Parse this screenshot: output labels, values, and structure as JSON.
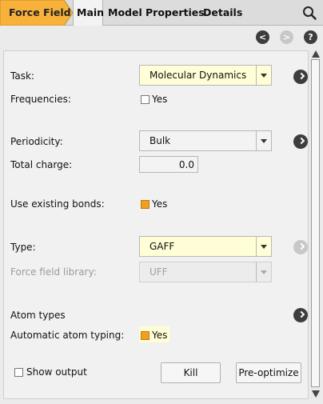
{
  "tabs": {
    "force_field": "Force Field",
    "main": "Main",
    "model": "Model",
    "properties": "Properties",
    "details": "Details"
  },
  "nav": {
    "back": "<",
    "forward": ">",
    "help": "?"
  },
  "fields": {
    "task": {
      "label": "Task:",
      "value": "Molecular Dynamics"
    },
    "frequencies": {
      "label": "Frequencies:",
      "checked": false,
      "option": "Yes"
    },
    "periodicity": {
      "label": "Periodicity:",
      "value": "Bulk"
    },
    "total_charge": {
      "label": "Total charge:",
      "value": "0.0"
    },
    "use_existing_bonds": {
      "label": "Use existing bonds:",
      "checked": true,
      "option": "Yes"
    },
    "type": {
      "label": "Type:",
      "value": "GAFF"
    },
    "force_field_library": {
      "label": "Force field library:",
      "value": "UFF",
      "disabled": true
    },
    "atom_types": {
      "label": "Atom types"
    },
    "automatic_atom_typing": {
      "label": "Automatic atom typing:",
      "checked": true,
      "option": "Yes"
    }
  },
  "footer": {
    "show_output": "Show output",
    "kill": "Kill",
    "preoptimize": "Pre-optimize"
  },
  "colors": {
    "accent": "#f0a020",
    "tab_active": "#f8b23c",
    "highlight": "#fffed6"
  }
}
